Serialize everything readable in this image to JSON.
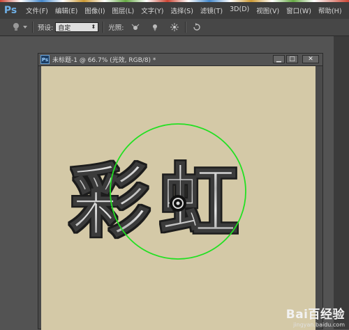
{
  "app": {
    "logo": "Ps"
  },
  "menu": [
    "文件(F)",
    "编辑(E)",
    "图像(I)",
    "图层(L)",
    "文字(Y)",
    "选择(S)",
    "滤镜(T)",
    "3D(D)",
    "视图(V)",
    "窗口(W)",
    "帮助(H)"
  ],
  "options": {
    "preset_label": "预设:",
    "preset_value": "自定",
    "light_label": "光照:"
  },
  "document": {
    "title": "未标题-1 @ 66.7% (光效, RGB/8) *",
    "canvas_text": "彩虹",
    "colors": {
      "canvas": "#d4c9a7",
      "light_ring": "#22e022"
    }
  },
  "watermark": {
    "brand": "Bai百经验",
    "url": "jingyan.baidu.com"
  }
}
